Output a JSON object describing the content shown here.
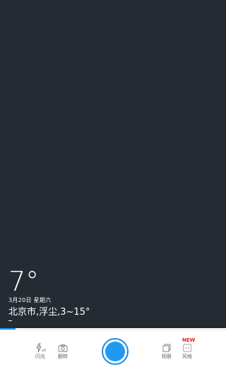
{
  "weather": {
    "temperature": "7°",
    "date": "3月20日  星期六",
    "location_summary": "北京市,浮尘,3~15°"
  },
  "progress": {
    "fraction": 0.07
  },
  "toolbar": {
    "flash_label": "闪光",
    "flip_label": "翻转",
    "album_label": "相册",
    "style_label": "风格",
    "style_badge": "NEW"
  },
  "colors": {
    "viewfinder_bg": "#252b33",
    "accent": "#1e9bf0",
    "badge": "#e02020"
  },
  "icons": [
    "flash-off-icon",
    "camera-flip-icon",
    "shutter-button",
    "album-icon",
    "style-icon"
  ]
}
